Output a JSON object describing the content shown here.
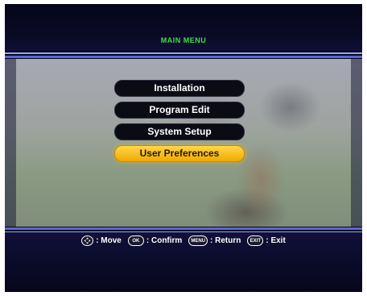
{
  "header": {
    "title": "MAIN MENU"
  },
  "menu": {
    "items": [
      {
        "label": "Installation",
        "selected": false
      },
      {
        "label": "Program Edit",
        "selected": false
      },
      {
        "label": "System Setup",
        "selected": false
      },
      {
        "label": "User Preferences",
        "selected": true
      }
    ]
  },
  "footer": {
    "keys": [
      {
        "icon": "dpad-icon",
        "icon_text": "",
        "label": ": Move"
      },
      {
        "icon": "ok-button-icon",
        "icon_text": "OK",
        "label": ": Confirm"
      },
      {
        "icon": "menu-button-icon",
        "icon_text": "MENU",
        "label": ": Return"
      },
      {
        "icon": "exit-button-icon",
        "icon_text": "EXIT",
        "label": ": Exit"
      }
    ]
  },
  "colors": {
    "title": "#3ee04a",
    "highlight": "#ffc820",
    "accent_line": "#5a66d8",
    "background": "#06061a"
  }
}
